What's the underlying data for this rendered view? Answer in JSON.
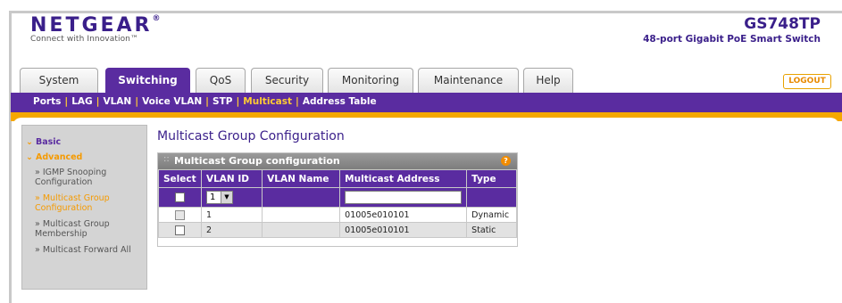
{
  "header": {
    "logo_text": "NETGEAR",
    "logo_reg": "®",
    "logo_tagline": "Connect with Innovation™",
    "product_model": "GS748TP",
    "product_description": "48-port Gigabit PoE Smart Switch",
    "logout_label": "LOGOUT"
  },
  "tabs": [
    {
      "label": "System",
      "active": false
    },
    {
      "label": "Switching",
      "active": true
    },
    {
      "label": "QoS",
      "active": false
    },
    {
      "label": "Security",
      "active": false
    },
    {
      "label": "Monitoring",
      "active": false
    },
    {
      "label": "Maintenance",
      "active": false
    },
    {
      "label": "Help",
      "active": false
    }
  ],
  "subnav": {
    "items": [
      "Ports",
      "LAG",
      "VLAN",
      "Voice VLAN",
      "STP",
      "Multicast",
      "Address Table"
    ],
    "active": "Multicast"
  },
  "sidebar": {
    "basic_label": "Basic",
    "advanced_label": "Advanced",
    "items": [
      {
        "label": "» IGMP Snooping Configuration",
        "active": false
      },
      {
        "label": "» Multicast Group Configuration",
        "active": true
      },
      {
        "label": "» Multicast Group Membership",
        "active": false
      },
      {
        "label": "» Multicast Forward All",
        "active": false
      }
    ]
  },
  "page": {
    "title": "Multicast Group Configuration",
    "panel_title": "Multicast Group configuration",
    "help_icon_glyph": "?"
  },
  "table": {
    "columns": [
      "Select",
      "VLAN ID",
      "VLAN Name",
      "Multicast Address",
      "Type"
    ],
    "input_row": {
      "vlan_select_value": "1",
      "vlan_select_arrow": "▼",
      "multicast_address_value": ""
    },
    "rows": [
      {
        "vlan_id": "1",
        "vlan_name": "",
        "multicast_address": "01005e010101",
        "type": "Dynamic",
        "checkbox_disabled": true
      },
      {
        "vlan_id": "2",
        "vlan_name": "",
        "multicast_address": "01005e010101",
        "type": "Static",
        "checkbox_disabled": false
      }
    ]
  },
  "colors": {
    "brand_purple": "#5a2ca0",
    "accent_orange": "#f5a800"
  }
}
